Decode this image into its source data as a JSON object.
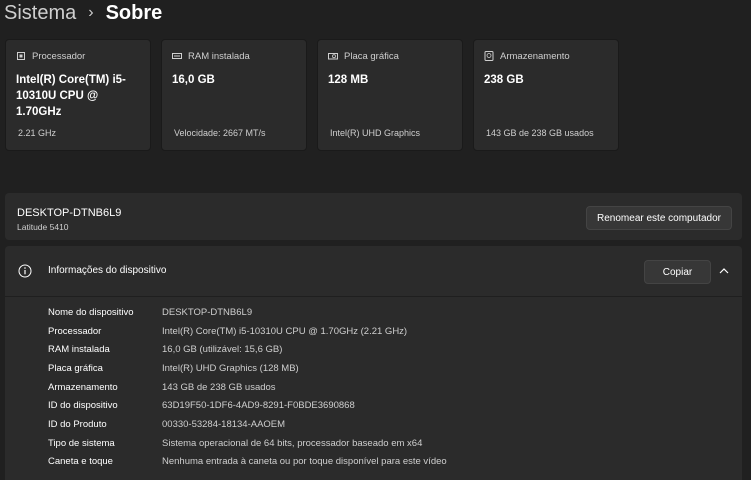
{
  "breadcrumb": {
    "parent": "Sistema",
    "separator": "›",
    "current": "Sobre"
  },
  "cards": [
    {
      "icon": "processor-icon",
      "label": "Processador",
      "value": "Intel(R) Core(TM) i5-10310U CPU @ 1.70GHz",
      "sub": "2.21 GHz"
    },
    {
      "icon": "ram-icon",
      "label": "RAM instalada",
      "value": "16,0 GB",
      "sub": "Velocidade: 2667 MT/s"
    },
    {
      "icon": "graphics-card-icon",
      "label": "Placa gráfica",
      "value": "128 MB",
      "sub": "Intel(R) UHD Graphics"
    },
    {
      "icon": "storage-icon",
      "label": "Armazenamento",
      "value": "238 GB",
      "sub": "143 GB de 238 GB usados"
    }
  ],
  "pc": {
    "name": "DESKTOP-DTNB6L9",
    "model": "Latitude 5410",
    "rename_label": "Renomear este computador"
  },
  "device_info": {
    "title": "Informações do dispositivo",
    "copy_label": "Copiar",
    "rows": [
      {
        "label": "Nome do dispositivo",
        "value": "DESKTOP-DTNB6L9"
      },
      {
        "label": "Processador",
        "value": "Intel(R) Core(TM) i5-10310U CPU @ 1.70GHz (2.21 GHz)"
      },
      {
        "label": "RAM instalada",
        "value": "16,0 GB (utilizável: 15,6 GB)"
      },
      {
        "label": "Placa gráfica",
        "value": "Intel(R) UHD Graphics (128 MB)"
      },
      {
        "label": "Armazenamento",
        "value": "143 GB de 238 GB usados"
      },
      {
        "label": "ID do dispositivo",
        "value": "63D19F50-1DF6-4AD9-8291-F0BDE3690868"
      },
      {
        "label": "ID do Produto",
        "value": "00330-53284-18134-AAOEM"
      },
      {
        "label": "Tipo de sistema",
        "value": "Sistema operacional de 64 bits, processador baseado em x64"
      },
      {
        "label": "Caneta e toque",
        "value": "Nenhuma entrada à caneta ou por toque disponível para este vídeo"
      }
    ]
  }
}
